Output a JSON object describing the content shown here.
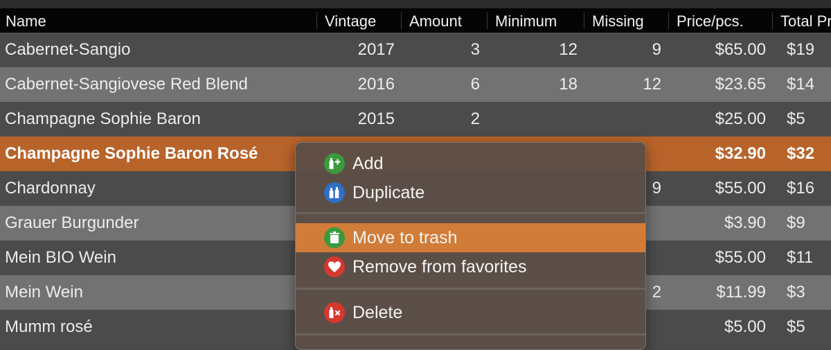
{
  "table": {
    "columns": [
      "Name",
      "Vintage",
      "Amount",
      "Minimum",
      "Missing",
      "Price/pcs.",
      "Total Pr"
    ],
    "rows": [
      {
        "name": "Cabernet-Sangio",
        "vintage": "2017",
        "amount": "3",
        "minimum": "12",
        "missing": "9",
        "price": "$65.00",
        "total": "$19"
      },
      {
        "name": "Cabernet-Sangiovese Red Blend",
        "vintage": "2016",
        "amount": "6",
        "minimum": "18",
        "missing": "12",
        "price": "$23.65",
        "total": "$14"
      },
      {
        "name": "Champagne Sophie Baron",
        "vintage": "2015",
        "amount": "2",
        "minimum": "",
        "missing": "",
        "price": "$25.00",
        "total": "$5"
      },
      {
        "name": "Champagne Sophie Baron Rosé",
        "vintage": "",
        "amount": "",
        "minimum": "",
        "missing": "",
        "price": "$32.90",
        "total": "$32",
        "selected": true
      },
      {
        "name": "Chardonnay",
        "vintage": "",
        "amount": "",
        "minimum": "",
        "missing": "9",
        "price": "$55.00",
        "total": "$16"
      },
      {
        "name": "Grauer Burgunder",
        "vintage": "",
        "amount": "",
        "minimum": "",
        "missing": "",
        "price": "$3.90",
        "total": "$9"
      },
      {
        "name": "Mein BIO Wein",
        "vintage": "",
        "amount": "",
        "minimum": "",
        "missing": "",
        "price": "$55.00",
        "total": "$11"
      },
      {
        "name": "Mein Wein",
        "vintage": "",
        "amount": "",
        "minimum": "",
        "missing": "2",
        "price": "$11.99",
        "total": "$3"
      },
      {
        "name": "Mumm rosé",
        "vintage": "",
        "amount": "",
        "minimum": "",
        "missing": "",
        "price": "$5.00",
        "total": "$5"
      }
    ]
  },
  "context_menu": {
    "items": [
      {
        "label": "Add",
        "icon": "add-bottle-icon",
        "color": "#3a9a3c"
      },
      {
        "label": "Duplicate",
        "icon": "duplicate-bottles-icon",
        "color": "#2f6fc7"
      },
      {
        "label": "Move to trash",
        "icon": "trash-icon",
        "color": "#3a9a3c",
        "highlighted": true
      },
      {
        "label": "Remove from favorites",
        "icon": "heart-icon",
        "color": "#d6382e"
      },
      {
        "label": "Delete",
        "icon": "delete-bottle-icon",
        "color": "#d6382e"
      }
    ]
  },
  "colors": {
    "selection": "#b8632a",
    "menu_highlight": "#d17c38",
    "header_bg": "#050505"
  }
}
